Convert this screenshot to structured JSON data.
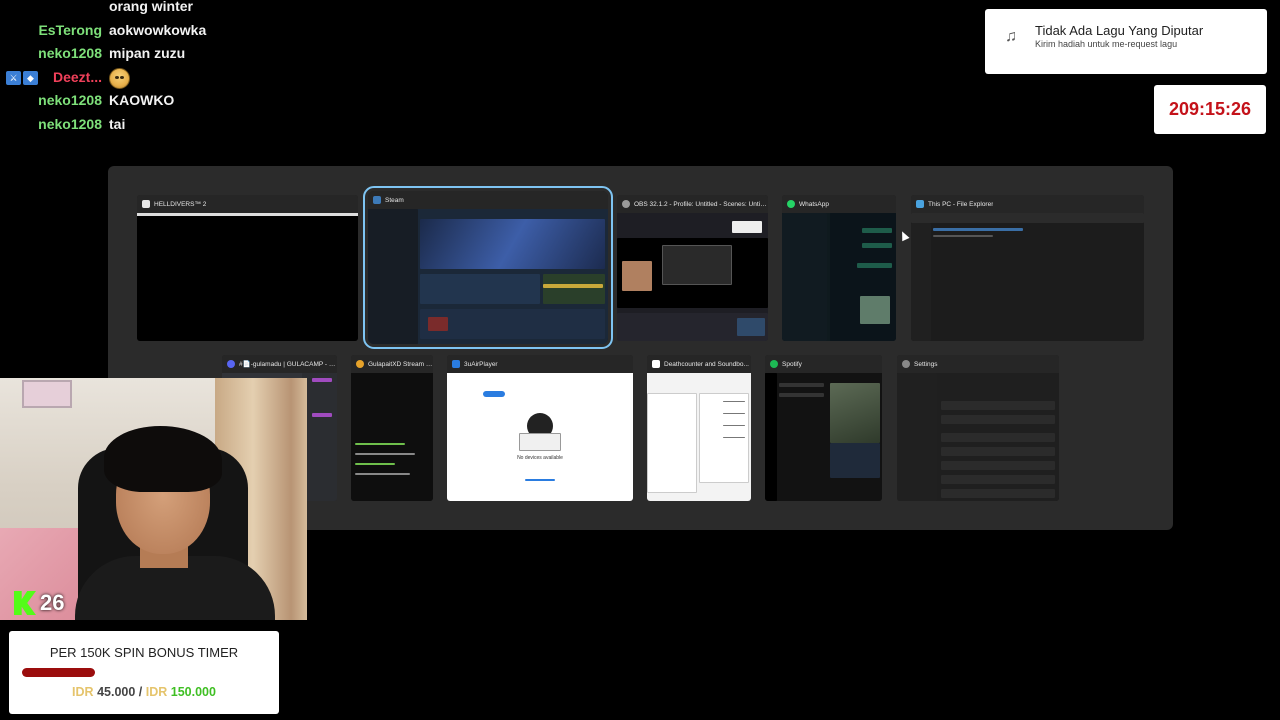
{
  "chat": {
    "messages": [
      {
        "user": "",
        "text": "orang winter",
        "user_color": "#7ee07a",
        "emote": false,
        "badges": []
      },
      {
        "user": "EsTerong",
        "text": "aokwowkowka",
        "user_color": "#7ee07a",
        "emote": false,
        "badges": []
      },
      {
        "user": "neko1208",
        "text": "mipan zuzu",
        "user_color": "#7ee07a",
        "emote": false,
        "badges": []
      },
      {
        "user": "Deezt...",
        "text": "",
        "user_color": "#f0405a",
        "emote": true,
        "badges": [
          "badge-1",
          "badge-2"
        ]
      },
      {
        "user": "neko1208",
        "text": "KAOWKO",
        "user_color": "#7ee07a",
        "emote": false,
        "badges": []
      },
      {
        "user": "neko1208",
        "text": "tai",
        "user_color": "#7ee07a",
        "emote": false,
        "badges": []
      }
    ]
  },
  "music": {
    "icon": "music-note-icon",
    "title": "Tidak Ada Lagu Yang Diputar",
    "subtitle": "Kirim hadiah untuk me-request lagu"
  },
  "timer": {
    "value": "209:15:26",
    "color": "#c4121a"
  },
  "task_view": {
    "row1": [
      {
        "title": "HELLDIVERS™ 2",
        "icon_color": "#e8e8e8",
        "selected": false
      },
      {
        "title": "Steam",
        "icon_color": "#3d7ab8",
        "selected": true
      },
      {
        "title": "OBS 32.1.2 - Profile: Untitled - Scenes: Untitled",
        "icon_color": "#9a9a9a",
        "selected": false
      },
      {
        "title": "WhatsApp",
        "icon_color": "#25d366",
        "selected": false
      },
      {
        "title": "This PC - File Explorer",
        "icon_color": "#4aa3df",
        "selected": false
      }
    ],
    "row2": [
      {
        "title": "#📄-gulamadu | GULACAMP - D...",
        "icon_color": "#5865f2",
        "selected": false
      },
      {
        "title": "GulapaitXD Stream -...",
        "icon_color": "#e6a22a",
        "selected": false
      },
      {
        "title": "3uAirPlayer",
        "icon_color": "#2a7ce0",
        "selected": false
      },
      {
        "title": "Deathcounter and Soundbo...",
        "icon_color": "#ffffff",
        "selected": false
      },
      {
        "title": "Spotify",
        "icon_color": "#1db954",
        "selected": false
      },
      {
        "title": "Settings",
        "icon_color": "#888888",
        "selected": false
      }
    ],
    "airplayer_text": "No devices available"
  },
  "stream": {
    "viewer_count": "26",
    "spin_title": "PER 150K SPIN BONUS TIMER",
    "currency": "IDR",
    "current": "45.000",
    "separator": "/",
    "target": "150.000",
    "progress": 0.3
  }
}
